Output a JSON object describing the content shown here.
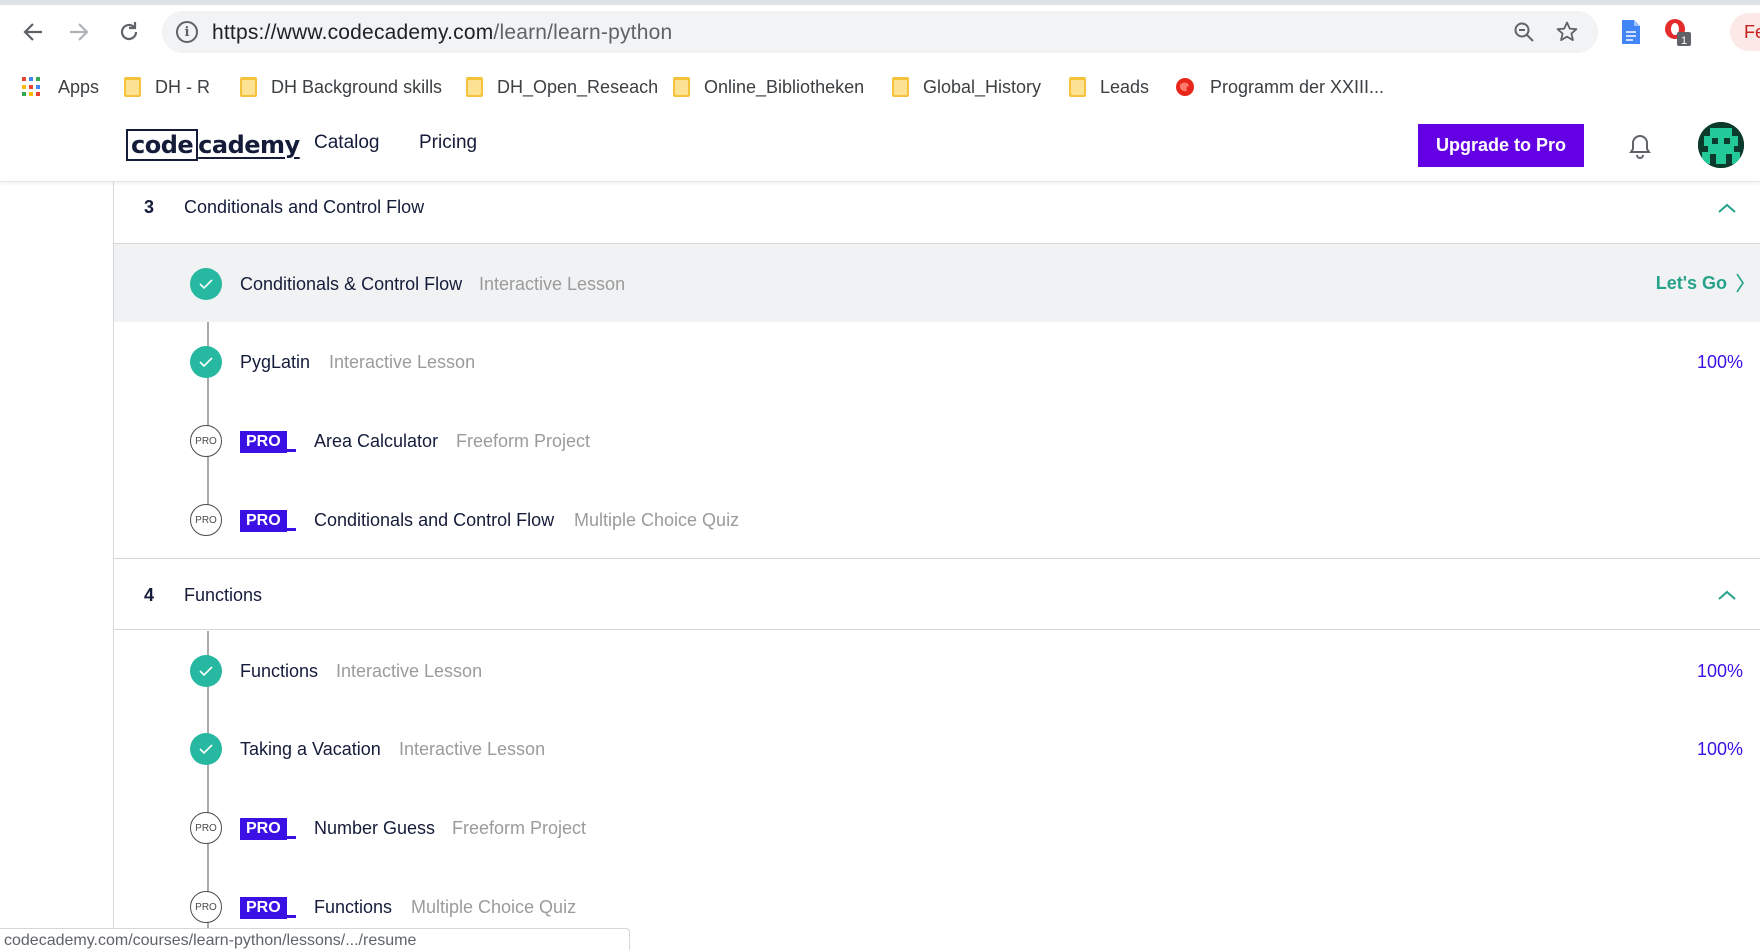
{
  "browser": {
    "url_host": "https://www.codecademy.com",
    "url_path": "/learn/learn-python",
    "extension_badge": "1",
    "profile_label": "Fe",
    "bookmarks": [
      {
        "label": "Apps",
        "icon": "apps-grid-icon"
      },
      {
        "label": "DH - R",
        "icon": "folder-icon"
      },
      {
        "label": "DH Background skills",
        "icon": "folder-icon"
      },
      {
        "label": "DH_Open_Reseach",
        "icon": "folder-icon"
      },
      {
        "label": "Online_Bibliotheken",
        "icon": "folder-icon"
      },
      {
        "label": "Global_History",
        "icon": "folder-icon"
      },
      {
        "label": "Leads",
        "icon": "folder-icon"
      },
      {
        "label": "Programm der XXIII...",
        "icon": "red-favicon"
      }
    ],
    "status_url": "codecademy.com/courses/learn-python/lessons/.../resume"
  },
  "header": {
    "logo_boxed": "code",
    "logo_rest": "cademy",
    "nav": [
      "Catalog",
      "Pricing"
    ],
    "upgrade_label": "Upgrade to Pro"
  },
  "colors": {
    "accent_purple": "#6400e4",
    "pro_blue": "#3a10e5",
    "check_teal": "#26b8a0",
    "lets_go_green": "#26a28b"
  },
  "modules": [
    {
      "number": "3",
      "title": "Conditionals and Control Flow",
      "lessons": [
        {
          "title": "Conditionals & Control Flow",
          "type": "Interactive Lesson",
          "status": "complete",
          "action": "Let's Go"
        },
        {
          "title": "PygLatin",
          "type": "Interactive Lesson",
          "status": "complete",
          "progress": "100%"
        },
        {
          "title": "Area Calculator",
          "type": "Freeform Project",
          "status": "pro",
          "pro_label": "PRO",
          "circle_label": "PRO"
        },
        {
          "title": "Conditionals and Control Flow",
          "type": "Multiple Choice Quiz",
          "status": "pro",
          "pro_label": "PRO",
          "circle_label": "PRO"
        }
      ]
    },
    {
      "number": "4",
      "title": "Functions",
      "lessons": [
        {
          "title": "Functions",
          "type": "Interactive Lesson",
          "status": "complete",
          "progress": "100%"
        },
        {
          "title": "Taking a Vacation",
          "type": "Interactive Lesson",
          "status": "complete",
          "progress": "100%"
        },
        {
          "title": "Number Guess",
          "type": "Freeform Project",
          "status": "pro",
          "pro_label": "PRO",
          "circle_label": "PRO"
        },
        {
          "title": "Functions",
          "type": "Multiple Choice Quiz",
          "status": "pro",
          "pro_label": "PRO",
          "circle_label": "PRO"
        }
      ]
    }
  ]
}
